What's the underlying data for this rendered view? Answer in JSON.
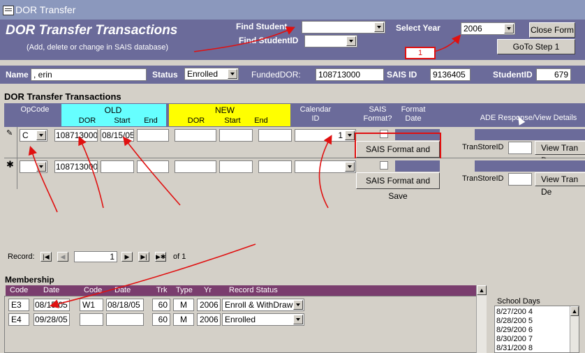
{
  "window": {
    "title": "DOR Transfer"
  },
  "header": {
    "title": "DOR Transfer Transactions",
    "subtitle": "(Add, delete or change in SAIS database)",
    "find_student_label": "Find Student",
    "find_student_value": "",
    "find_studentid_label": "Find StudentID",
    "find_studentid_value": "",
    "select_year_label": "Select Year",
    "select_year_value": "2006",
    "close_label": "Close Form",
    "goto_label": "GoTo Step 1",
    "callout_number": "1"
  },
  "student": {
    "name_label": "Name",
    "name_value": ", erin",
    "status_label": "Status",
    "status_value": "Enrolled",
    "funded_label": "FundedDOR:",
    "funded_value": "108713000",
    "sais_label": "SAIS ID",
    "sais_value": "9136405",
    "studentid_label": "StudentID",
    "studentid_value": "679"
  },
  "transactions": {
    "section_title": "DOR Transfer Transactions",
    "headers": {
      "opcode": "OpCode",
      "old": "OLD",
      "new": "NEW",
      "dor": "DOR",
      "start": "Start",
      "end": "End",
      "calendar1": "Calendar",
      "calendar2": "ID",
      "sais1": "SAIS",
      "sais2": "Format?",
      "format1": "Format",
      "format2": "Date",
      "ade": "ADE Response/View Details"
    },
    "rows": [
      {
        "selector": "✎",
        "opcode": "C",
        "old_dor": "108713000",
        "old_start": "08/15/05",
        "calendar": "1",
        "save_label": "SAIS Format and Save",
        "transtore_label": "TranStoreID",
        "view_label": "View Tran De"
      },
      {
        "selector": "✱",
        "opcode": "",
        "old_dor": "108713000",
        "old_start": "",
        "calendar": "",
        "save_label": "SAIS Format and Save",
        "transtore_label": "TranStoreID",
        "view_label": "View Tran De"
      }
    ],
    "record_label": "Record:",
    "record_value": "1",
    "record_of": "of  1"
  },
  "membership": {
    "title": "Membership",
    "headers": [
      "Code",
      "Date",
      "Code",
      "Date",
      "Trk",
      "Type",
      "Yr",
      "Record Status"
    ],
    "rows": [
      {
        "code": "E3",
        "date": "08/15/05",
        "wcode": "W1",
        "wdate": "08/18/05",
        "trk": "60",
        "type": "M",
        "yr": "2006",
        "status": "Enroll & WithDrawn"
      },
      {
        "code": "E4",
        "date": "09/28/05",
        "wcode": "",
        "wdate": "",
        "trk": "60",
        "type": "M",
        "yr": "2006",
        "status": "Enrolled"
      }
    ]
  },
  "school_days": {
    "title": "School Days",
    "items": [
      {
        "date": "8/27/200",
        "num": "4"
      },
      {
        "date": "8/28/200",
        "num": "5"
      },
      {
        "date": "8/29/200",
        "num": "6"
      },
      {
        "date": "8/30/200",
        "num": "7"
      },
      {
        "date": "8/31/200",
        "num": "8"
      }
    ]
  },
  "colors": {
    "header_bg": "#6b6b9a",
    "old_bg": "#66ffff",
    "new_bg": "#ffff00",
    "annotation": "#e01010",
    "membership_head": "#7a3d6e"
  }
}
